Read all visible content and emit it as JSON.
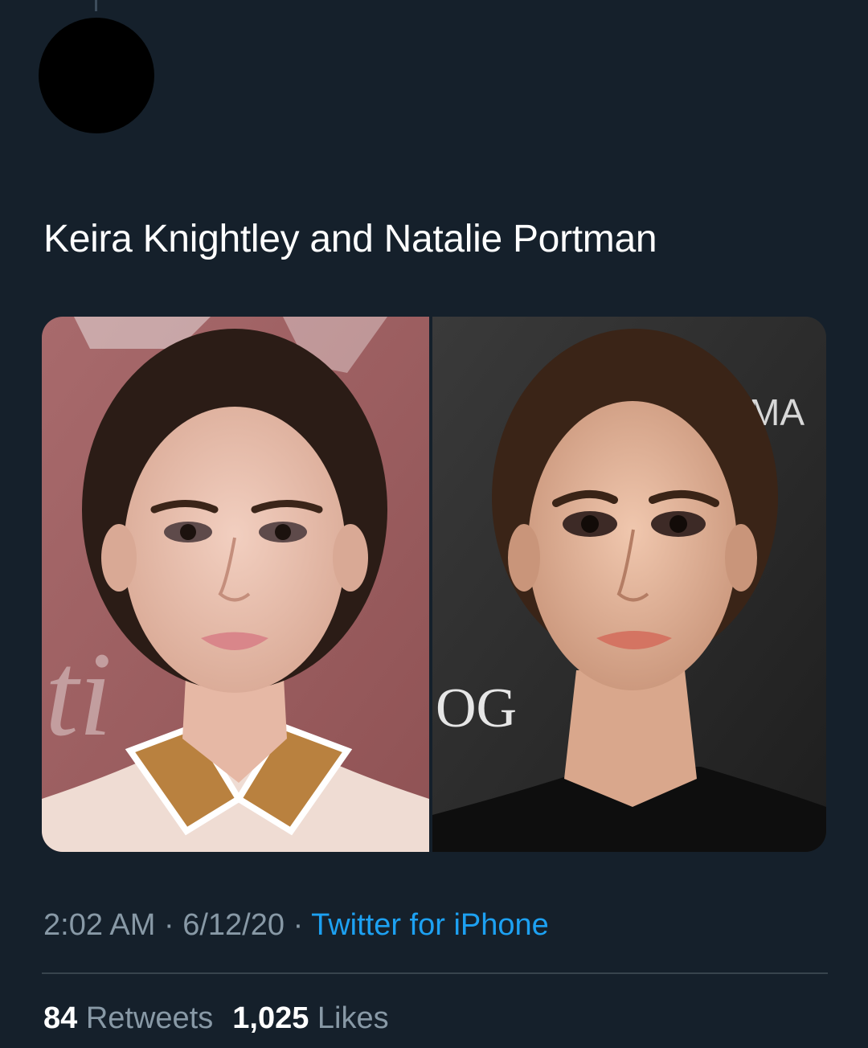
{
  "tweet": {
    "text": "Keira Knightley and Natalie Portman",
    "time": "2:02 AM",
    "date": "6/12/20",
    "separator": "·",
    "source": "Twitter for iPhone"
  },
  "media": {
    "left_backdrop_text": "ti",
    "right_backdrop_text_top": "MA",
    "right_backdrop_text_mid": "OG"
  },
  "stats": {
    "retweets_count": "84",
    "retweets_label": "Retweets",
    "likes_count": "1,025",
    "likes_label": "Likes"
  },
  "colors": {
    "background": "#15202b",
    "text": "#ffffff",
    "secondary_text": "#8899a6",
    "link": "#1da1f2",
    "divider": "#38444d"
  }
}
